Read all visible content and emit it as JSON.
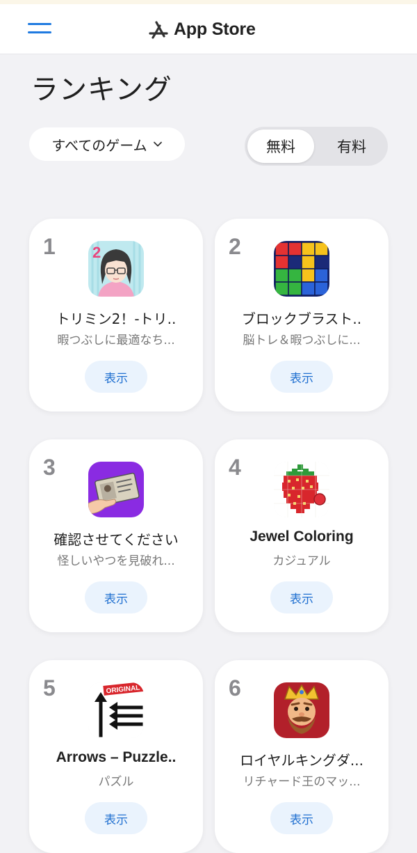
{
  "header": {
    "brand": "App Store"
  },
  "page": {
    "title": "ランキング",
    "category": "すべてのゲーム",
    "segments": {
      "free": "無料",
      "paid": "有料",
      "selected": "free"
    }
  },
  "apps": [
    {
      "rank": "1",
      "name": "トリミン2！-トリ..",
      "subtitle": "暇つぶしに最適なち...",
      "button": "表示",
      "icon": "anime-girl-icon"
    },
    {
      "rank": "2",
      "name": "ブロックブラスト..",
      "subtitle": "脳トレ＆暇つぶしに...",
      "button": "表示",
      "icon": "block-puzzle-icon"
    },
    {
      "rank": "3",
      "name": "確認させてください",
      "subtitle": "怪しいやつを見破れ...",
      "button": "表示",
      "icon": "id-card-icon"
    },
    {
      "rank": "4",
      "name": "Jewel Coloring",
      "subtitle": "カジュアル",
      "button": "表示",
      "icon": "pixel-strawberry-icon"
    },
    {
      "rank": "5",
      "name": "Arrows – Puzzle..",
      "subtitle": "パズル",
      "button": "表示",
      "icon": "arrows-icon",
      "badge": "ORIGINAL"
    },
    {
      "rank": "6",
      "name": "ロイヤルキングダ...",
      "subtitle": "リチャード王のマッ...",
      "button": "表示",
      "icon": "king-icon"
    }
  ],
  "colors": {
    "accent": "#1f7ae0",
    "background": "#f2f2f5",
    "card": "#ffffff",
    "button_bg": "#eaf3fd"
  }
}
